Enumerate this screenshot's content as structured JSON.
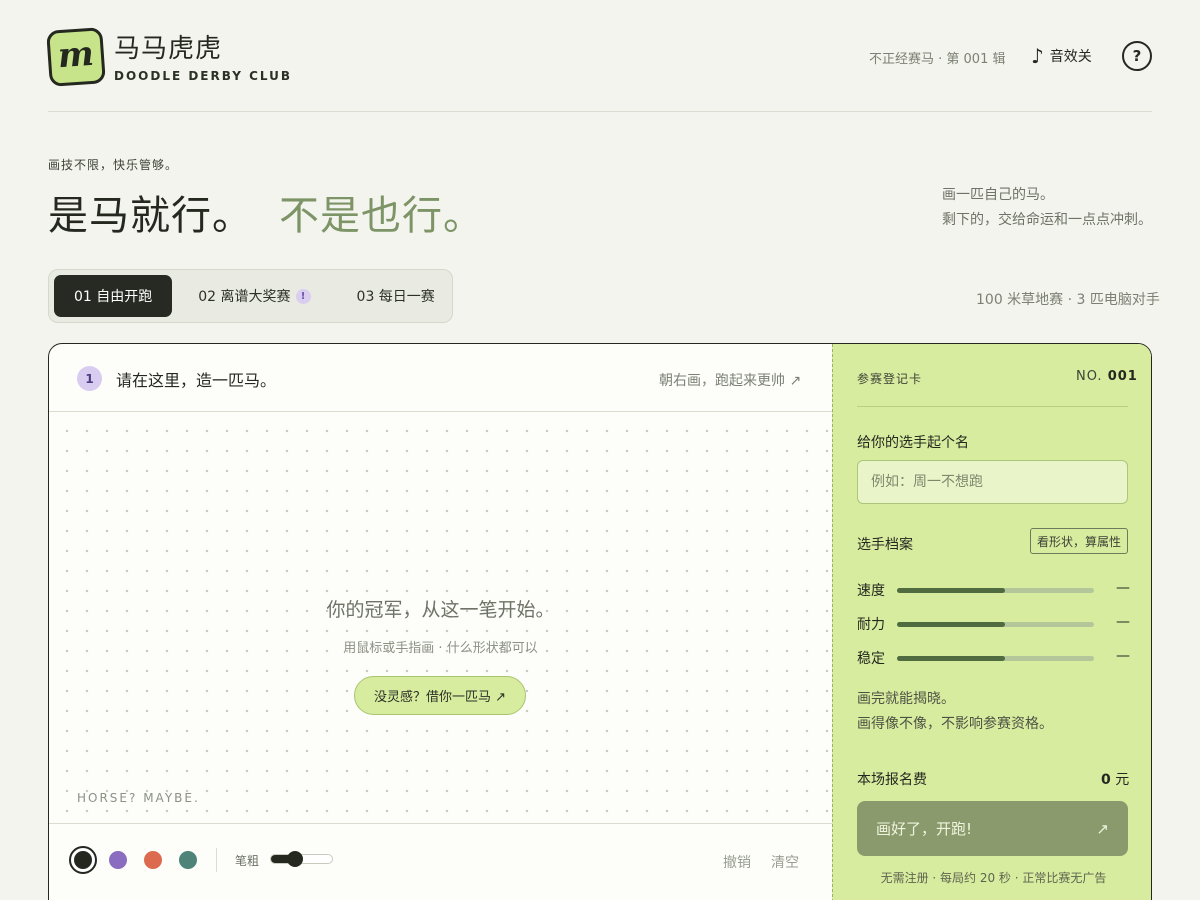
{
  "brand": {
    "logo_letter": "m",
    "title": "马马虎虎",
    "subtitle": "DOODLE DERBY CLUB"
  },
  "header": {
    "issue": "不正经赛马 · 第 001 辑",
    "sound_icon": "♪",
    "sound_label": "音效关",
    "help_label": "?"
  },
  "hero": {
    "tagline": "画技不限，快乐管够。",
    "headline_main": "是马就行。",
    "headline_accent": "不是也行。",
    "desc_line1": "画一匹自己的马。",
    "desc_line2": "剩下的，交给命运和一点点冲刺。"
  },
  "tabs": [
    {
      "label": "01 自由开跑",
      "active": true
    },
    {
      "label": "02 离谱大奖赛",
      "badge": "!"
    },
    {
      "label": "03 每日一赛"
    }
  ],
  "race_info": "100 米草地赛 · 3 匹电脑对手",
  "canvas": {
    "step": "1",
    "title": "请在这里，造一匹马。",
    "hint": "朝右画，跑起来更帅 ↗",
    "empty_title": "你的冠军，从这一笔开始。",
    "empty_sub": "用鼠标或手指画 · 什么形状都可以",
    "inspire_button": "没灵感？借你一匹马 ↗",
    "watermark": "HORSE? MAYBE."
  },
  "toolbar": {
    "colors": [
      "#24281f",
      "#8a6cc0",
      "#dc6a4f",
      "#4d8378"
    ],
    "selected_color": 0,
    "brush_label": "笔粗",
    "brush_level": 0.3,
    "undo_label": "撤销",
    "clear_label": "清空"
  },
  "registration": {
    "title": "参赛登记卡",
    "no_label": "NO.",
    "no_value": "001",
    "name_label": "给你的选手起个名",
    "name_placeholder": "例如：周一不想跑",
    "profile_label": "选手档案",
    "profile_tag": "看形状，算属性",
    "stats": [
      {
        "label": "速度",
        "value": "—",
        "level": 0.55
      },
      {
        "label": "耐力",
        "value": "—",
        "level": 0.55
      },
      {
        "label": "稳定",
        "value": "—",
        "level": 0.55
      }
    ],
    "reveal_line1": "画完就能揭晓。",
    "reveal_line2": "画得像不像，不影响参赛资格。",
    "fee_label": "本场报名费",
    "fee_value": "0",
    "fee_unit": "元",
    "go_button": "画好了，开跑!",
    "go_arrow": "↗",
    "note": "无需注册 · 每局约 20 秒 · 正常比赛无广告"
  }
}
